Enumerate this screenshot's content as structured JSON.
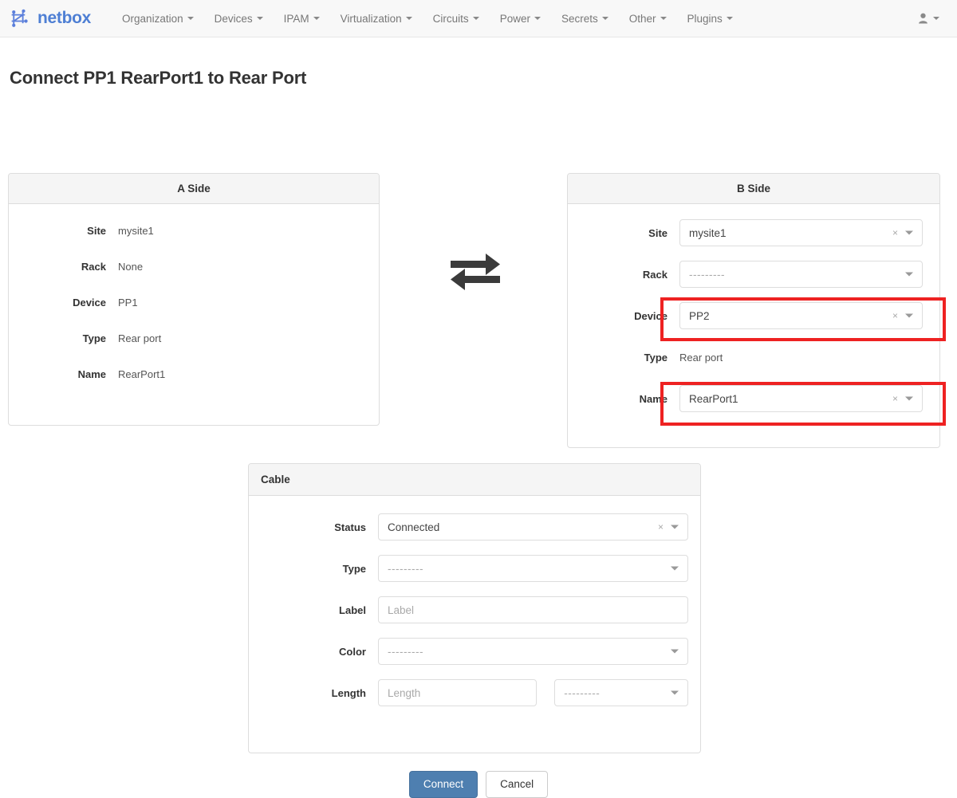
{
  "navbar": {
    "brand": "netbox",
    "brand_color": "#4e7fd4",
    "logo_icon": "netbox-node-logo",
    "menu": [
      {
        "label": "Organization",
        "icon": "chevron-down-icon"
      },
      {
        "label": "Devices",
        "icon": "chevron-down-icon"
      },
      {
        "label": "IPAM",
        "icon": "chevron-down-icon"
      },
      {
        "label": "Virtualization",
        "icon": "chevron-down-icon"
      },
      {
        "label": "Circuits",
        "icon": "chevron-down-icon"
      },
      {
        "label": "Power",
        "icon": "chevron-down-icon"
      },
      {
        "label": "Secrets",
        "icon": "chevron-down-icon"
      },
      {
        "label": "Other",
        "icon": "chevron-down-icon"
      },
      {
        "label": "Plugins",
        "icon": "chevron-down-icon"
      }
    ],
    "user_menu": {
      "icon": "user-icon",
      "caret": "chevron-down-icon"
    }
  },
  "page": {
    "title": "Connect PP1 RearPort1 to Rear Port"
  },
  "a_side": {
    "heading": "A Side",
    "rows": [
      {
        "label": "Site",
        "value": "mysite1"
      },
      {
        "label": "Rack",
        "value": "None"
      },
      {
        "label": "Device",
        "value": "PP1"
      },
      {
        "label": "Type",
        "value": "Rear port"
      },
      {
        "label": "Name",
        "value": "RearPort1"
      }
    ]
  },
  "swap": {
    "icon": "exchange-arrows-icon"
  },
  "b_side": {
    "heading": "B Side",
    "site": {
      "label": "Site",
      "value": "mysite1",
      "clear": "×",
      "caret": "caret-down-icon"
    },
    "rack": {
      "label": "Rack",
      "value": "---------",
      "caret": "caret-down-icon"
    },
    "device": {
      "label": "Device",
      "value": "PP2",
      "clear": "×",
      "caret": "caret-down-icon",
      "highlighted": true
    },
    "type": {
      "label": "Type",
      "value": "Rear port"
    },
    "name": {
      "label": "Name",
      "value": "RearPort1",
      "clear": "×",
      "caret": "caret-down-icon",
      "highlighted": true
    }
  },
  "highlight_color": "#ee2222",
  "cable": {
    "heading": "Cable",
    "status": {
      "label": "Status",
      "value": "Connected",
      "clear": "×",
      "caret": "caret-down-icon"
    },
    "type": {
      "label": "Type",
      "value": "---------",
      "caret": "caret-down-icon"
    },
    "cable_label": {
      "label": "Label",
      "value": "",
      "placeholder": "Label"
    },
    "color": {
      "label": "Color",
      "value": "---------",
      "caret": "caret-down-icon"
    },
    "length": {
      "label": "Length",
      "value": "",
      "placeholder": "Length",
      "unit_value": "---------",
      "caret": "caret-down-icon"
    }
  },
  "actions": {
    "submit": "Connect",
    "cancel": "Cancel",
    "submit_color": "#4e7fb0"
  }
}
